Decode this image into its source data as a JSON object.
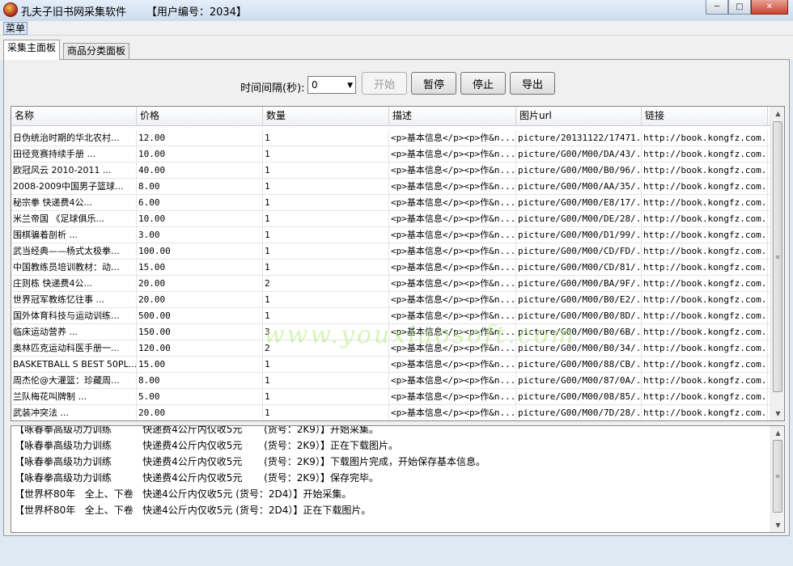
{
  "window": {
    "title": "孔夫子旧书网采集软件",
    "user_tag": "【用户编号：2034】",
    "minimize": "─",
    "maximize": "□",
    "close": "✕"
  },
  "menu": {
    "label": "菜单"
  },
  "tabs": [
    {
      "label": "采集主面板",
      "active": true
    },
    {
      "label": "商品分类面板",
      "active": false
    }
  ],
  "controls": {
    "interval_label": "时间间隔(秒):",
    "interval_value": "0",
    "start_label": "开始",
    "pause_label": "暂停",
    "stop_label": "停止",
    "export_label": "导出"
  },
  "table": {
    "columns": [
      "名称",
      "价格",
      "数量",
      "描述",
      "图片url",
      "链接"
    ],
    "rows": [
      [
        "日伪统治时期的华北农村...",
        "12.00",
        "1",
        "<p>基本信息</p><p>作&n...",
        "picture/20131122/17471...",
        "http://book.kongfz.com..."
      ],
      [
        "田径竞赛持续手册      ...",
        "10.00",
        "1",
        "<p>基本信息</p><p>作&n...",
        "picture/G00/M00/DA/43/...",
        "http://book.kongfz.com..."
      ],
      [
        "欧冠风云  2010-2011    ...",
        "40.00",
        "1",
        "<p>基本信息</p><p>作&n...",
        "picture/G00/M00/B0/96/...",
        "http://book.kongfz.com..."
      ],
      [
        "2008-2009中国男子篮球...",
        "8.00",
        "1",
        "<p>基本信息</p><p>作&n...",
        "picture/G00/M00/AA/35/...",
        "http://book.kongfz.com..."
      ],
      [
        "秘宗拳      快递费4公...",
        "6.00",
        "1",
        "<p>基本信息</p><p>作&n...",
        "picture/G00/M00/E8/17/...",
        "http://book.kongfz.com..."
      ],
      [
        "米兰帝国      《足球俱乐...",
        "10.00",
        "1",
        "<p>基本信息</p><p>作&n...",
        "picture/G00/M00/DE/28/...",
        "http://book.kongfz.com..."
      ],
      [
        "围棋骗着剖析           ...",
        "3.00",
        "1",
        "<p>基本信息</p><p>作&n...",
        "picture/G00/M00/D1/99/...",
        "http://book.kongfz.com..."
      ],
      [
        "武当经典——杨式太极拳...",
        "100.00",
        "1",
        "<p>基本信息</p><p>作&n...",
        "picture/G00/M00/CD/FD/...",
        "http://book.kongfz.com..."
      ],
      [
        "中国教练员培训教材：动...",
        "15.00",
        "1",
        "<p>基本信息</p><p>作&n...",
        "picture/G00/M00/CD/81/...",
        "http://book.kongfz.com..."
      ],
      [
        "庄则栋      快递费4公...",
        "20.00",
        "2",
        "<p>基本信息</p><p>作&n...",
        "picture/G00/M00/BA/9F/...",
        "http://book.kongfz.com..."
      ],
      [
        "世界冠军教练忆往事     ...",
        "20.00",
        "1",
        "<p>基本信息</p><p>作&n...",
        "picture/G00/M00/B0/E2/...",
        "http://book.kongfz.com..."
      ],
      [
        "国外体育科技与运动训练...",
        "500.00",
        "1",
        "<p>基本信息</p><p>作&n...",
        "picture/G00/M00/B0/8D/...",
        "http://book.kongfz.com..."
      ],
      [
        "临床运动营养           ...",
        "150.00",
        "3",
        "<p>基本信息</p><p>作&n...",
        "picture/G00/M00/B0/6B/...",
        "http://book.kongfz.com..."
      ],
      [
        "奥林匹克运动科医手册一...",
        "120.00",
        "2",
        "<p>基本信息</p><p>作&n...",
        "picture/G00/M00/B0/34/...",
        "http://book.kongfz.com..."
      ],
      [
        "BASKETBALL S BEST 50PL...",
        "15.00",
        "1",
        "<p>基本信息</p><p>作&n...",
        "picture/G00/M00/88/CB/...",
        "http://book.kongfz.com..."
      ],
      [
        "周杰伦@大灌篮：珍藏周...",
        "8.00",
        "1",
        "<p>基本信息</p><p>作&n...",
        "picture/G00/M00/87/0A/...",
        "http://book.kongfz.com..."
      ],
      [
        "兰队梅花叫牌制         ...",
        "5.00",
        "1",
        "<p>基本信息</p><p>作&n...",
        "picture/G00/M00/08/85/...",
        "http://book.kongfz.com..."
      ],
      [
        "武装冲突法             ...",
        "20.00",
        "1",
        "<p>基本信息</p><p>作&n...",
        "picture/G00/M00/7D/28/...",
        "http://book.kongfz.com..."
      ]
    ]
  },
  "watermark": "www.youxiaosoft.com",
  "log": [
    "【咏春拳高级功力训练          快递费4公斤内仅收5元       (货号：2K9）】开始采集。",
    "【咏春拳高级功力训练          快递费4公斤内仅收5元       (货号：2K9）】正在下载图片。",
    "【咏春拳高级功力训练          快递费4公斤内仅收5元       (货号：2K9）】下载图片完成，开始保存基本信息。",
    "【咏春拳高级功力训练          快递费4公斤内仅收5元       (货号：2K9）】保存完毕。",
    "【世界杯80年   全上、下卷   快递4公斤内仅收5元 (货号：2D4）】开始采集。",
    "【世界杯80年   全上、下卷   快递4公斤内仅收5元 (货号：2D4）】正在下载图片。"
  ]
}
